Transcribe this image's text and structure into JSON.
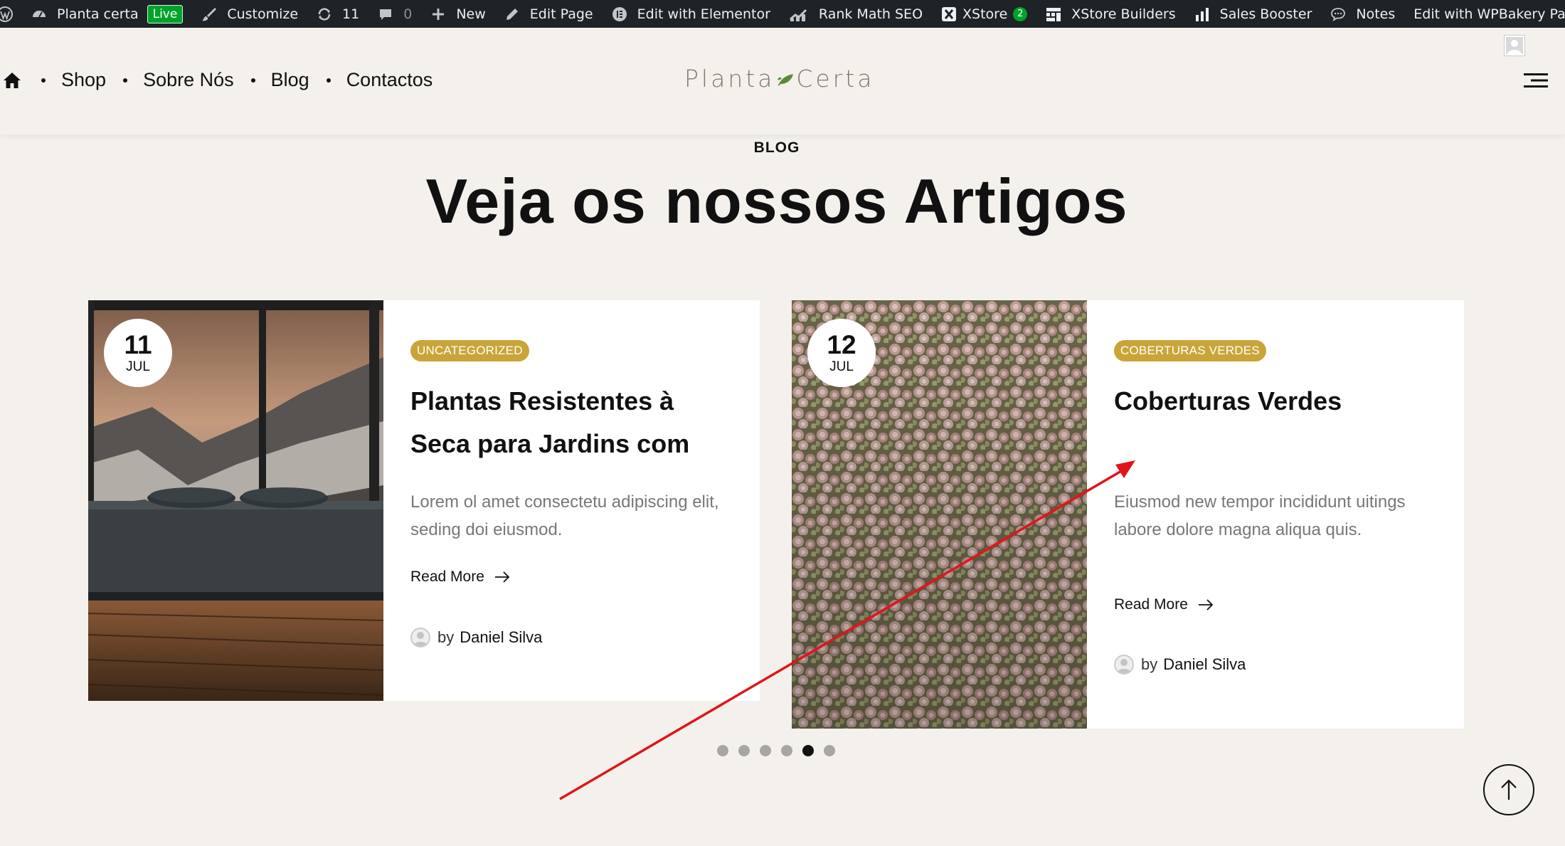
{
  "adminbar": {
    "site_name": "Planta certa",
    "live_badge": "Live",
    "customize": "Customize",
    "updates_count": "11",
    "comments_count": "0",
    "new": "New",
    "edit_page": "Edit Page",
    "elementor": "Edit with Elementor",
    "rank_math": "Rank Math SEO",
    "xstore": "XStore",
    "xstore_count": "2",
    "xstore_builders": "XStore Builders",
    "sales_booster": "Sales Booster",
    "notes": "Notes",
    "wpbakery": "Edit with WPBakery Page Builder"
  },
  "header": {
    "nav": [
      "Shop",
      "Sobre Nós",
      "Blog",
      "Contactos"
    ],
    "logo_left": "Planta",
    "logo_right": "Certa"
  },
  "section": {
    "eyebrow": "BLOG",
    "title": "Veja os nossos Artigos"
  },
  "posts": [
    {
      "day": "11",
      "month": "JUL",
      "category": "UNCATEGORIZED",
      "title": "Plantas Resistentes à Seca para Jardins com",
      "excerpt": "Lorem ol amet consectetu adipiscing elit, seding doi eiusmod.",
      "read_more": "Read More",
      "by": "by",
      "author": "Daniel Silva"
    },
    {
      "day": "12",
      "month": "JUL",
      "category": "COBERTURAS VERDES",
      "title": "Coberturas Verdes",
      "excerpt": "Eiusmod new tempor incididunt uitings labore dolore magna aliqua quis.",
      "read_more": "Read More",
      "by": "by",
      "author": "Daniel Silva"
    }
  ],
  "pagination": {
    "total": 6,
    "active_index": 4
  },
  "colors": {
    "adminbar_bg": "#1d2327",
    "page_bg": "#f4f1ec",
    "category_badge": "#c9a438",
    "live_badge": "#00a32a",
    "annotation_arrow": "#e0151b"
  },
  "icons": [
    "wordpress-icon",
    "dashboard-icon",
    "brush-icon",
    "updates-icon",
    "comment-icon",
    "plus-icon",
    "pencil-icon",
    "elementor-icon",
    "rank-math-icon",
    "xstore-icon",
    "builders-icon",
    "bar-chart-icon",
    "notes-icon",
    "home-icon",
    "hamburger-menu-icon",
    "arrow-right-icon",
    "arrow-up-icon"
  ]
}
